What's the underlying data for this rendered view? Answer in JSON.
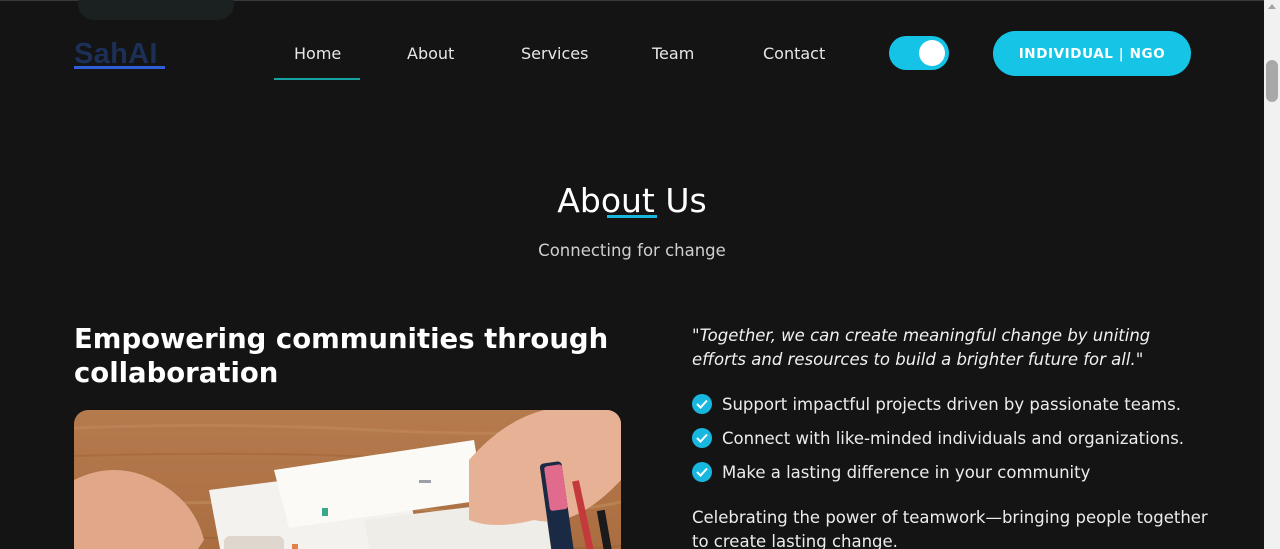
{
  "header": {
    "logo": "SahAI",
    "nav": [
      {
        "label": "Home",
        "active": true
      },
      {
        "label": "About",
        "active": false
      },
      {
        "label": "Services",
        "active": false
      },
      {
        "label": "Team",
        "active": false
      },
      {
        "label": "Contact",
        "active": false
      }
    ],
    "theme_toggle_on": true,
    "cta_label": "INDIVIDUAL | NGO"
  },
  "about": {
    "title": "About Us",
    "subtitle": "Connecting for change",
    "headline": "Empowering communities through collaboration",
    "quote": "\"Together, we can create meaningful change by uniting efforts and resources to build a brighter future for all.\"",
    "features": [
      "Support impactful projects driven by passionate teams.",
      "Connect with like-minded individuals and organizations.",
      "Make a lasting difference in your community"
    ],
    "closing": "Celebrating the power of teamwork—bringing people together to create lasting change."
  },
  "colors": {
    "accent": "#16c5e6",
    "background": "#141414",
    "logo": "#1c2f57"
  }
}
